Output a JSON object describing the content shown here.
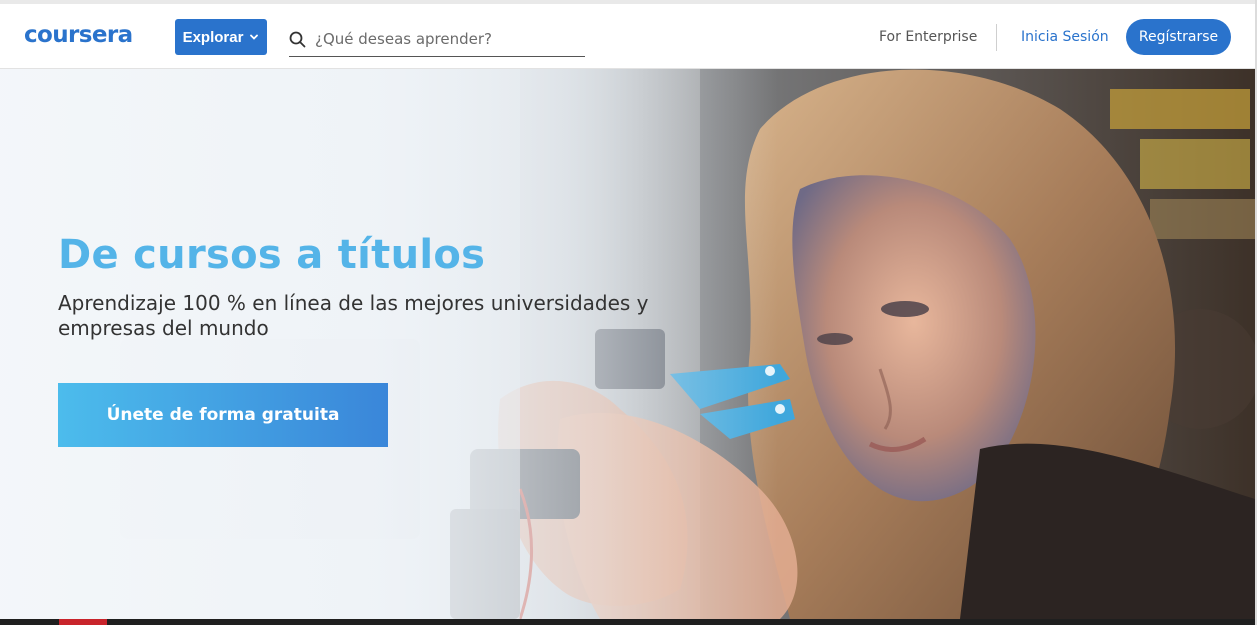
{
  "header": {
    "logo_text": "coursera",
    "explore_label": "Explorar",
    "search_placeholder": "¿Qué deseas aprender?",
    "enterprise_label": "For Enterprise",
    "login_label": "Inicia Sesión",
    "register_label": "Regístrarse",
    "brand_color": "#2a73cc"
  },
  "hero": {
    "title": "De cursos a títulos",
    "subtitle": "Aprendizaje 100 % en línea de las mejores universidades y empresas del mundo",
    "cta_label": "Únete de forma gratuita",
    "title_color": "#54b4e8",
    "cta_colors": [
      "#4cbcec",
      "#3a86d9"
    ]
  },
  "icons": {
    "search": "search-icon",
    "explore_chevron": "chevron-down-icon"
  }
}
